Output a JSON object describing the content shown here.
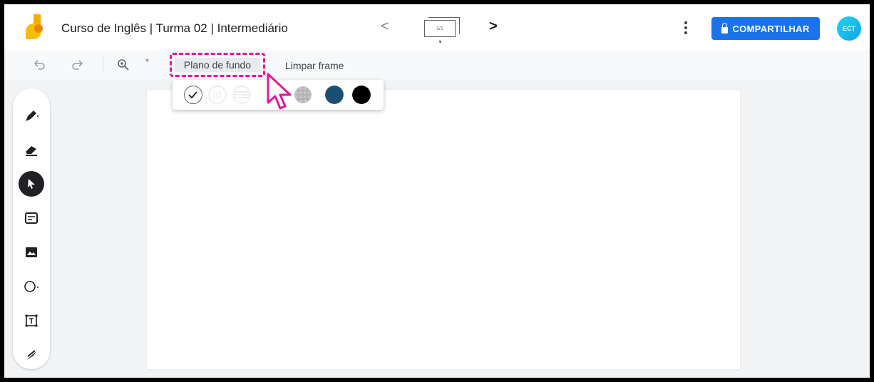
{
  "header": {
    "title": "Curso de Inglês | Turma 02 | Intermediário",
    "prev_label": "<",
    "frame_counter": "1/1",
    "next_label": ">",
    "share_label": "COMPARTILHAR",
    "avatar_text": "ECT"
  },
  "toolbar": {
    "background_label": "Plano de fundo",
    "clear_frame_label": "Limpar frame"
  },
  "tools": [
    {
      "name": "pen-tool"
    },
    {
      "name": "eraser-tool"
    },
    {
      "name": "select-tool",
      "active": true
    },
    {
      "name": "sticky-note-tool"
    },
    {
      "name": "image-tool"
    },
    {
      "name": "shape-tool"
    },
    {
      "name": "text-box-tool"
    },
    {
      "name": "laser-tool"
    }
  ],
  "background_options": [
    {
      "name": "blank",
      "selected": true
    },
    {
      "name": "dot-grid"
    },
    {
      "name": "lined"
    },
    {
      "name": "grid"
    },
    {
      "name": "blue",
      "color": "#1b4f72"
    },
    {
      "name": "black",
      "color": "#000000"
    }
  ],
  "colors": {
    "accent": "#1a73e8",
    "highlight": "#e0189a"
  }
}
